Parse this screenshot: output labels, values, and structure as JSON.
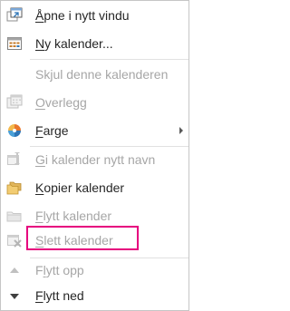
{
  "menu": {
    "items": [
      {
        "label": "Åpne i nytt vindu",
        "access_key": "Å",
        "icon": "open-new-window-icon",
        "disabled": false
      },
      {
        "label": "Ny kalender...",
        "access_key": "N",
        "icon": "new-calendar-icon",
        "disabled": false
      },
      {
        "label": "Skjul denne kalenderen",
        "access_key": "j",
        "icon": "",
        "disabled": true
      },
      {
        "label": "Overlegg",
        "access_key": "O",
        "icon": "overlay-icon",
        "disabled": true
      },
      {
        "label": "Farge",
        "access_key": "F",
        "icon": "color-palette-icon",
        "disabled": false,
        "has_submenu": true
      },
      {
        "label": "Gi kalender nytt navn",
        "access_key": "G",
        "icon": "rename-calendar-icon",
        "disabled": true
      },
      {
        "label": "Kopier kalender",
        "access_key": "K",
        "icon": "copy-calendar-folder-icon",
        "disabled": false
      },
      {
        "label": "Flytt kalender",
        "access_key": "F",
        "icon": "move-calendar-folder-icon",
        "disabled": true
      },
      {
        "label": "Slett kalender",
        "access_key": "S",
        "icon": "delete-calendar-icon",
        "disabled": true,
        "highlighted": true
      },
      {
        "label": "Flytt opp",
        "access_key": "l",
        "icon": "move-up-triangle-icon",
        "disabled": true
      },
      {
        "label": "Flytt ned",
        "access_key": "F",
        "icon": "move-down-triangle-icon",
        "disabled": false
      }
    ]
  },
  "colors": {
    "text": "#262626",
    "disabled_text": "#a6a6a6",
    "highlight_border": "#e6007e",
    "menu_border": "#c6c6c6",
    "separator": "#e1e1e1"
  }
}
